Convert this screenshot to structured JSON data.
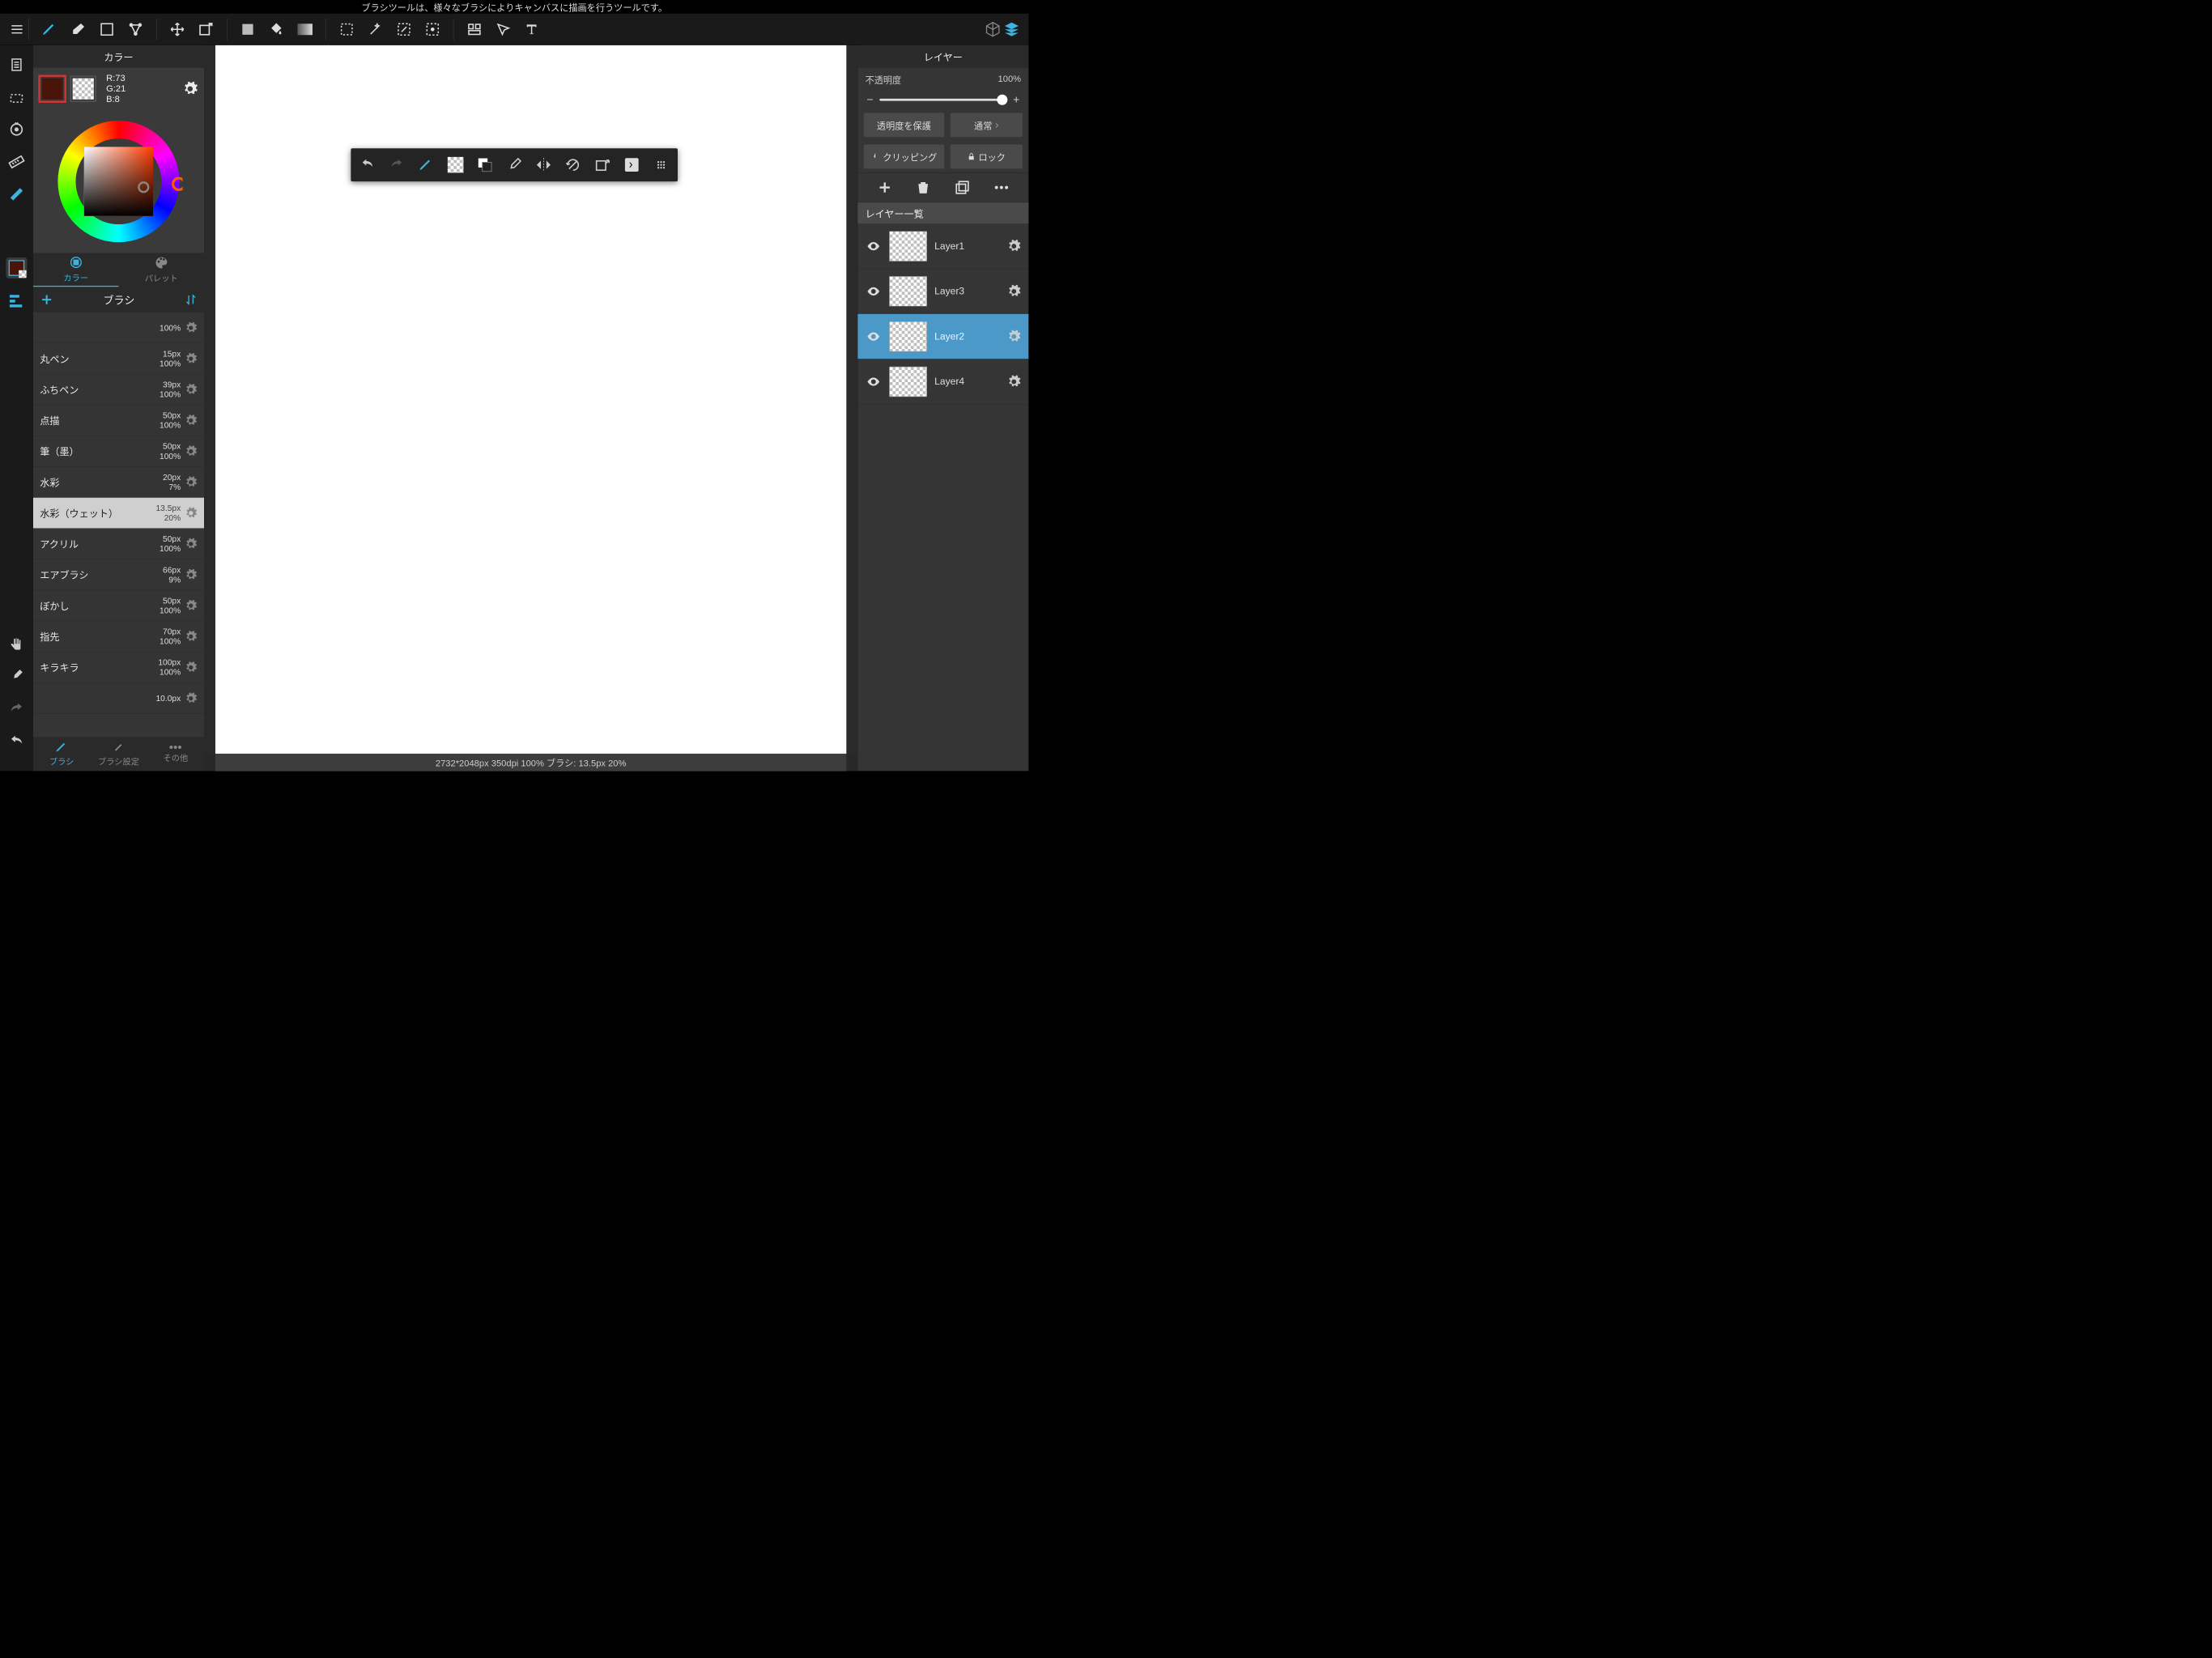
{
  "hint": "ブラシツールは、様々なブラシによりキャンバスに描画を行うツールです。",
  "color_panel": {
    "title": "カラー",
    "rgb": {
      "r": "R:73",
      "g": "G:21",
      "b": "B:8"
    },
    "fg": "#491508",
    "tabs": {
      "color": "カラー",
      "palette": "パレット"
    }
  },
  "brush_panel": {
    "title": "ブラシ",
    "brushes": [
      {
        "name": "",
        "size": "100%",
        "opacity": ""
      },
      {
        "name": "丸ペン",
        "size": "15px",
        "opacity": "100%"
      },
      {
        "name": "ふちペン",
        "size": "39px",
        "opacity": "100%"
      },
      {
        "name": "点描",
        "size": "50px",
        "opacity": "100%"
      },
      {
        "name": "筆（墨）",
        "size": "50px",
        "opacity": "100%"
      },
      {
        "name": "水彩",
        "size": "20px",
        "opacity": "7%"
      },
      {
        "name": "水彩（ウェット）",
        "size": "13.5px",
        "opacity": "20%",
        "selected": true
      },
      {
        "name": "アクリル",
        "size": "50px",
        "opacity": "100%"
      },
      {
        "name": "エアブラシ",
        "size": "66px",
        "opacity": "9%"
      },
      {
        "name": "ぼかし",
        "size": "50px",
        "opacity": "100%"
      },
      {
        "name": "指先",
        "size": "70px",
        "opacity": "100%"
      },
      {
        "name": "キラキラ",
        "size": "100px",
        "opacity": "100%"
      },
      {
        "name": "",
        "size": "10.0px",
        "opacity": ""
      }
    ],
    "bottom_tabs": {
      "brush": "ブラシ",
      "settings": "ブラシ設定",
      "other": "その他"
    }
  },
  "layers_panel": {
    "title": "レイヤー",
    "opacity_label": "不透明度",
    "opacity_value": "100%",
    "protect": "透明度を保護",
    "blend": "通常",
    "clipping": "クリッピング",
    "lock": "ロック",
    "list_title": "レイヤー一覧",
    "layers": [
      {
        "name": "Layer1",
        "indent": true
      },
      {
        "name": "Layer3",
        "indent": true
      },
      {
        "name": "Layer2",
        "selected": true,
        "indent": true
      },
      {
        "name": "Layer4",
        "indent": true
      }
    ]
  },
  "status": "2732*2048px 350dpi 100% ブラシ: 13.5px 20%"
}
